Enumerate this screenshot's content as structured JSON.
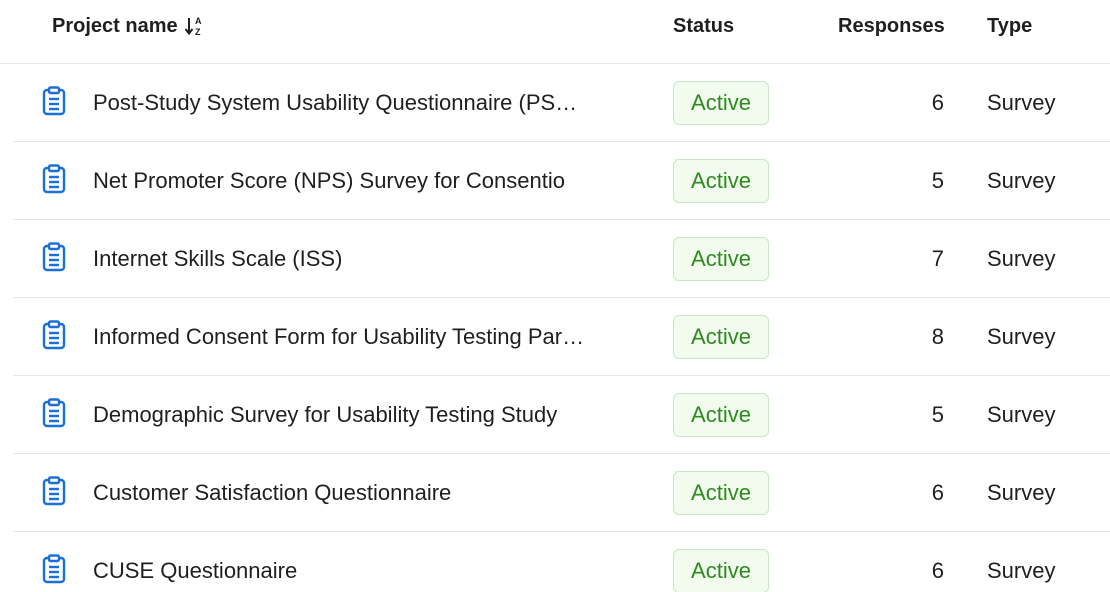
{
  "header": {
    "project_name": "Project name",
    "status": "Status",
    "responses": "Responses",
    "type": "Type",
    "sort_icon": "sort-alpha-down-icon"
  },
  "colors": {
    "icon_blue": "#1b6fd8",
    "active_text": "#2e8a1f",
    "active_bg": "#f1fbee",
    "active_border": "#c7e8c0",
    "divider": "#e6e6e6"
  },
  "rows": [
    {
      "name": "Post-Study System Usability Questionnaire (PS…",
      "status": "Active",
      "responses": "6",
      "type": "Survey",
      "icon": "clipboard-icon"
    },
    {
      "name": "Net Promoter Score (NPS) Survey for Consentio",
      "status": "Active",
      "responses": "5",
      "type": "Survey",
      "icon": "clipboard-icon"
    },
    {
      "name": "Internet Skills Scale (ISS)",
      "status": "Active",
      "responses": "7",
      "type": "Survey",
      "icon": "clipboard-icon"
    },
    {
      "name": "Informed Consent Form for Usability Testing Par…",
      "status": "Active",
      "responses": "8",
      "type": "Survey",
      "icon": "clipboard-icon"
    },
    {
      "name": "Demographic Survey for Usability Testing Study",
      "status": "Active",
      "responses": "5",
      "type": "Survey",
      "icon": "clipboard-icon"
    },
    {
      "name": "Customer Satisfaction Questionnaire",
      "status": "Active",
      "responses": "6",
      "type": "Survey",
      "icon": "clipboard-icon"
    },
    {
      "name": "CUSE Questionnaire",
      "status": "Active",
      "responses": "6",
      "type": "Survey",
      "icon": "clipboard-icon"
    }
  ]
}
